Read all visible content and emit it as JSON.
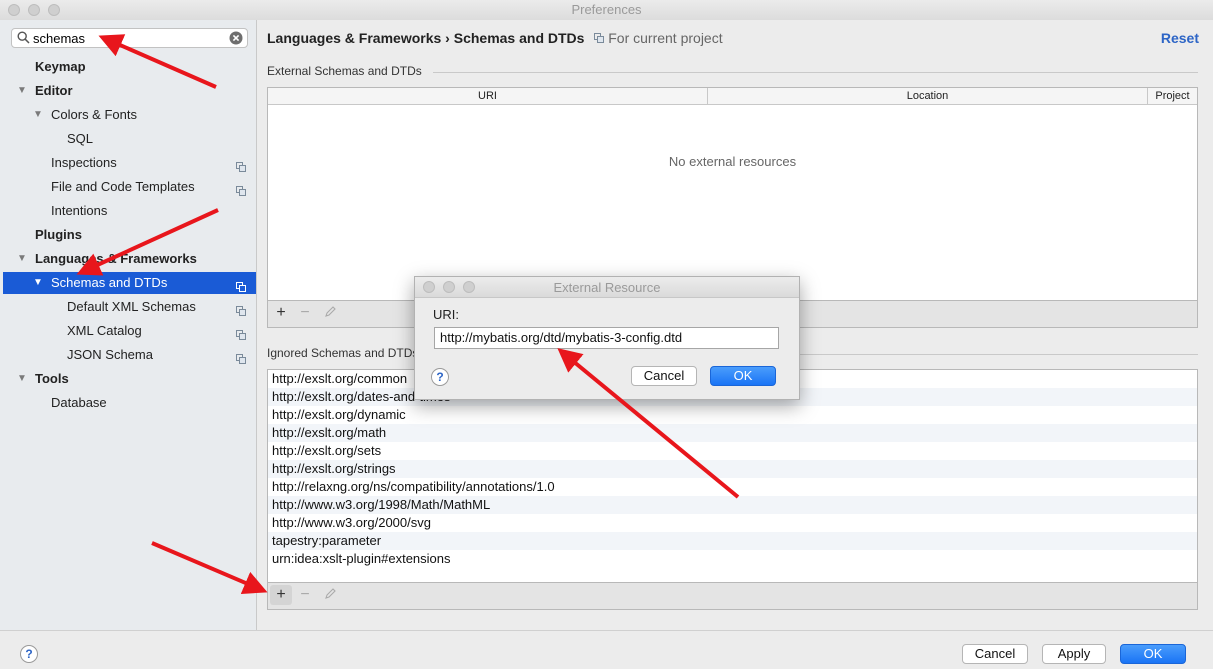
{
  "window": {
    "title": "Preferences"
  },
  "sidebar": {
    "search_value": "schemas",
    "items": [
      {
        "label": "Keymap"
      },
      {
        "label": "Editor"
      },
      {
        "label": "Colors & Fonts"
      },
      {
        "label": "SQL"
      },
      {
        "label": "Inspections"
      },
      {
        "label": "File and Code Templates"
      },
      {
        "label": "Intentions"
      },
      {
        "label": "Plugins"
      },
      {
        "label": "Languages & Frameworks"
      },
      {
        "label": "Schemas and DTDs"
      },
      {
        "label": "Default XML Schemas"
      },
      {
        "label": "XML Catalog"
      },
      {
        "label": "JSON Schema"
      },
      {
        "label": "Tools"
      },
      {
        "label": "Database"
      }
    ]
  },
  "content": {
    "breadcrumb_parent": "Languages & Frameworks",
    "breadcrumb_sep": "›",
    "breadcrumb_current": "Schemas and DTDs",
    "scope_label": "For current project",
    "reset_label": "Reset",
    "external_section_title": "External Schemas and DTDs",
    "columns": [
      "URI",
      "Location",
      "Project"
    ],
    "empty_text": "No external resources",
    "ignored_section_title": "Ignored Schemas and DTDs",
    "ignored": [
      "http://exslt.org/common",
      "http://exslt.org/dates-and-times",
      "http://exslt.org/dynamic",
      "http://exslt.org/math",
      "http://exslt.org/sets",
      "http://exslt.org/strings",
      "http://relaxng.org/ns/compatibility/annotations/1.0",
      "http://www.w3.org/1998/Math/MathML",
      "http://www.w3.org/2000/svg",
      "tapestry:parameter",
      "urn:idea:xslt-plugin#extensions"
    ]
  },
  "toolbar": {
    "add": "+",
    "remove": "−"
  },
  "dialog": {
    "title": "External Resource",
    "uri_label": "URI:",
    "uri_value": "http://mybatis.org/dtd/mybatis-3-config.dtd",
    "cancel": "Cancel",
    "ok": "OK",
    "help": "?"
  },
  "footer": {
    "help": "?",
    "cancel": "Cancel",
    "apply": "Apply",
    "ok": "OK"
  },
  "colors": {
    "selection": "#1a5bd6",
    "primary_button": "#1a74f5",
    "arrow": "#e8161c",
    "link": "#2d65c6"
  }
}
